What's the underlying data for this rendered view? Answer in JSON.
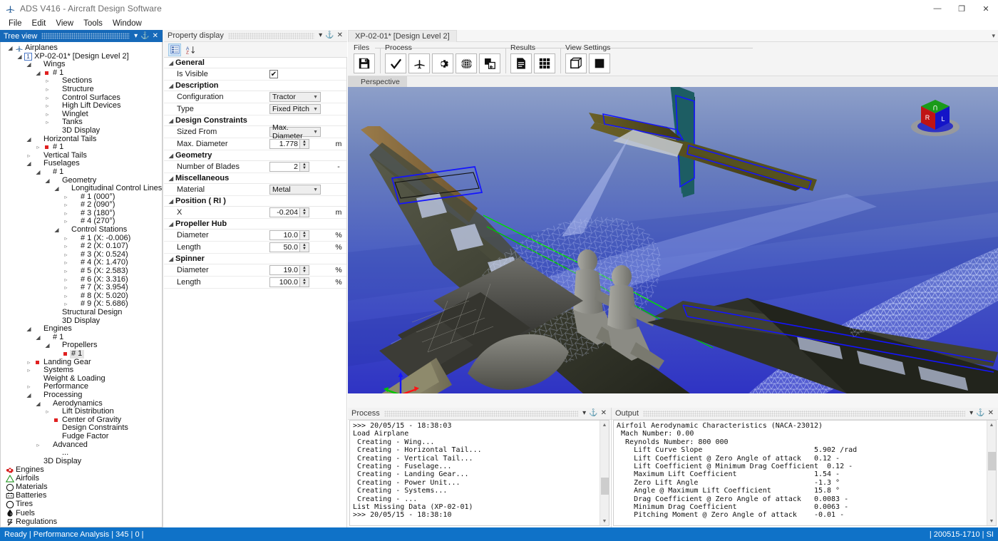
{
  "window": {
    "title": "ADS V416 - Aircraft Design Software",
    "app_icon": "airplane-icon",
    "minimize": "—",
    "maximize": "❐",
    "close": "✕"
  },
  "menu": {
    "items": [
      "File",
      "Edit",
      "View",
      "Tools",
      "Window"
    ]
  },
  "tree_panel": {
    "caption": "Tree view",
    "buttons": {
      "dropdown": "▾",
      "pin": "⚓",
      "close": "✕"
    },
    "nodes": [
      {
        "depth": 0,
        "exp": "open",
        "icon": "airplane-icon",
        "label": "Airplanes"
      },
      {
        "depth": 1,
        "exp": "open",
        "icon": "number-badge-1",
        "label": "XP-02-01* [Design Level 2]"
      },
      {
        "depth": 2,
        "exp": "open",
        "icon": "none",
        "label": "Wings"
      },
      {
        "depth": 3,
        "exp": "open",
        "icon": "red-dot",
        "label": "# 1"
      },
      {
        "depth": 4,
        "exp": "closed",
        "icon": "none",
        "label": "Sections"
      },
      {
        "depth": 4,
        "exp": "closed",
        "icon": "none",
        "label": "Structure"
      },
      {
        "depth": 4,
        "exp": "closed",
        "icon": "none",
        "label": "Control Surfaces"
      },
      {
        "depth": 4,
        "exp": "closed",
        "icon": "none",
        "label": "High Lift Devices"
      },
      {
        "depth": 4,
        "exp": "closed",
        "icon": "none",
        "label": "Winglet"
      },
      {
        "depth": 4,
        "exp": "closed",
        "icon": "none",
        "label": "Tanks"
      },
      {
        "depth": 4,
        "exp": "none",
        "icon": "none",
        "label": "3D Display"
      },
      {
        "depth": 2,
        "exp": "open",
        "icon": "none",
        "label": "Horizontal Tails"
      },
      {
        "depth": 3,
        "exp": "closed",
        "icon": "red-dot",
        "label": "# 1"
      },
      {
        "depth": 2,
        "exp": "closed",
        "icon": "none",
        "label": "Vertical Tails"
      },
      {
        "depth": 2,
        "exp": "open",
        "icon": "none",
        "label": "Fuselages"
      },
      {
        "depth": 3,
        "exp": "open",
        "icon": "none",
        "label": "# 1"
      },
      {
        "depth": 4,
        "exp": "open",
        "icon": "none",
        "label": "Geometry"
      },
      {
        "depth": 5,
        "exp": "open",
        "icon": "none",
        "label": "Longitudinal Control Lines"
      },
      {
        "depth": 6,
        "exp": "closed",
        "icon": "none",
        "label": "# 1 (000°)"
      },
      {
        "depth": 6,
        "exp": "closed",
        "icon": "none",
        "label": "# 2 (090°)"
      },
      {
        "depth": 6,
        "exp": "closed",
        "icon": "none",
        "label": "# 3 (180°)"
      },
      {
        "depth": 6,
        "exp": "closed",
        "icon": "none",
        "label": "# 4 (270°)"
      },
      {
        "depth": 5,
        "exp": "open",
        "icon": "none",
        "label": "Control Stations"
      },
      {
        "depth": 6,
        "exp": "closed",
        "icon": "none",
        "label": "# 1 (X: -0.006)"
      },
      {
        "depth": 6,
        "exp": "closed",
        "icon": "none",
        "label": "# 2 (X: 0.107)"
      },
      {
        "depth": 6,
        "exp": "closed",
        "icon": "none",
        "label": "# 3 (X: 0.524)"
      },
      {
        "depth": 6,
        "exp": "closed",
        "icon": "none",
        "label": "# 4 (X: 1.470)"
      },
      {
        "depth": 6,
        "exp": "closed",
        "icon": "none",
        "label": "# 5 (X: 2.583)"
      },
      {
        "depth": 6,
        "exp": "closed",
        "icon": "none",
        "label": "# 6 (X: 3.316)"
      },
      {
        "depth": 6,
        "exp": "closed",
        "icon": "none",
        "label": "# 7 (X: 3.954)"
      },
      {
        "depth": 6,
        "exp": "closed",
        "icon": "none",
        "label": "# 8 (X: 5.020)"
      },
      {
        "depth": 6,
        "exp": "closed",
        "icon": "none",
        "label": "# 9 (X: 5.686)"
      },
      {
        "depth": 4,
        "exp": "none",
        "icon": "none",
        "label": "Structural Design"
      },
      {
        "depth": 4,
        "exp": "none",
        "icon": "none",
        "label": "3D Display"
      },
      {
        "depth": 2,
        "exp": "open",
        "icon": "none",
        "label": "Engines"
      },
      {
        "depth": 3,
        "exp": "open",
        "icon": "none",
        "label": "# 1"
      },
      {
        "depth": 4,
        "exp": "open",
        "icon": "none",
        "label": "Propellers"
      },
      {
        "depth": 5,
        "exp": "none",
        "icon": "red-dot",
        "label": "# 1",
        "selected": true
      },
      {
        "depth": 2,
        "exp": "closed",
        "icon": "red-dot",
        "label": "Landing Gear"
      },
      {
        "depth": 2,
        "exp": "closed",
        "icon": "none",
        "label": "Systems"
      },
      {
        "depth": 2,
        "exp": "none",
        "icon": "none",
        "label": "Weight & Loading"
      },
      {
        "depth": 2,
        "exp": "closed",
        "icon": "none",
        "label": "Performance"
      },
      {
        "depth": 2,
        "exp": "open",
        "icon": "none",
        "label": "Processing"
      },
      {
        "depth": 3,
        "exp": "open",
        "icon": "none",
        "label": "Aerodynamics"
      },
      {
        "depth": 4,
        "exp": "closed",
        "icon": "none",
        "label": "Lift Distribution"
      },
      {
        "depth": 4,
        "exp": "none",
        "icon": "red-dot",
        "label": "Center of Gravity"
      },
      {
        "depth": 4,
        "exp": "none",
        "icon": "none",
        "label": "Design Constraints"
      },
      {
        "depth": 4,
        "exp": "none",
        "icon": "none",
        "label": "Fudge Factor"
      },
      {
        "depth": 3,
        "exp": "closed",
        "icon": "none",
        "label": "Advanced"
      },
      {
        "depth": 4,
        "exp": "none",
        "icon": "none",
        "label": "..."
      },
      {
        "depth": 2,
        "exp": "none",
        "icon": "none",
        "label": "3D Display"
      }
    ],
    "library": [
      {
        "icon": "engine-icon",
        "label": "Engines"
      },
      {
        "icon": "airfoil-icon",
        "label": "Airfoils"
      },
      {
        "icon": "material-icon",
        "label": "Materials"
      },
      {
        "icon": "battery-icon",
        "label": "Batteries"
      },
      {
        "icon": "tire-icon",
        "label": "Tires"
      },
      {
        "icon": "fuel-icon",
        "label": "Fuels"
      },
      {
        "icon": "regulation-icon",
        "label": "Regulations"
      }
    ]
  },
  "property_panel": {
    "caption": "Property display",
    "buttons": {
      "dropdown": "▾",
      "pin": "⚓",
      "close": "✕"
    },
    "toolbar": [
      {
        "name": "categorized-button",
        "glyph": "☷",
        "active": true
      },
      {
        "name": "sort-alpha-button",
        "glyph": "A↓",
        "active": false
      }
    ],
    "groups": [
      {
        "title": "General",
        "rows": [
          {
            "name": "Is Visible",
            "type": "checkbox",
            "value": "✔",
            "unit": ""
          }
        ]
      },
      {
        "title": "Description",
        "rows": [
          {
            "name": "Configuration",
            "type": "combo",
            "value": "Tractor",
            "unit": ""
          },
          {
            "name": "Type",
            "type": "combo",
            "value": "Fixed Pitch",
            "unit": ""
          }
        ]
      },
      {
        "title": "Design Constraints",
        "rows": [
          {
            "name": "Sized From",
            "type": "combo",
            "value": "Max. Diameter",
            "unit": ""
          },
          {
            "name": "Max. Diameter",
            "type": "spin",
            "value": "1.778",
            "unit": "m"
          }
        ]
      },
      {
        "title": "Geometry",
        "rows": [
          {
            "name": "Number of Blades",
            "type": "spin",
            "value": "2",
            "unit": "-"
          }
        ]
      },
      {
        "title": "Miscellaneous",
        "rows": [
          {
            "name": "Material",
            "type": "combo",
            "value": "Metal",
            "unit": ""
          }
        ]
      },
      {
        "title": "Position ( RI )",
        "rows": [
          {
            "name": "X",
            "type": "spin",
            "value": "-0.204",
            "unit": "m"
          }
        ]
      },
      {
        "title": "Propeller Hub",
        "rows": [
          {
            "name": "Diameter",
            "type": "spin",
            "value": "10.0",
            "unit": "%"
          },
          {
            "name": "Length",
            "type": "spin",
            "value": "50.0",
            "unit": "%"
          }
        ]
      },
      {
        "title": "Spinner",
        "rows": [
          {
            "name": "Diameter",
            "type": "spin",
            "value": "19.0",
            "unit": "%"
          },
          {
            "name": "Length",
            "type": "spin",
            "value": "100.0",
            "unit": "%"
          }
        ]
      }
    ]
  },
  "document": {
    "tab_label": "XP-02-01* [Design Level 2]",
    "dock_button": "▾",
    "ribbon_groups": [
      {
        "title": "Files",
        "buttons": [
          {
            "name": "save-button",
            "icon": "floppy-disk-icon"
          }
        ]
      },
      {
        "title": "Process",
        "buttons": [
          {
            "name": "check-button",
            "icon": "checkmark-icon"
          },
          {
            "name": "airplane-analysis-button",
            "icon": "airplane-icon"
          },
          {
            "name": "settings-button",
            "icon": "gear-icon"
          },
          {
            "name": "mesh-sphere-button",
            "icon": "mesh-sphere-icon"
          },
          {
            "name": "compare-button",
            "icon": "compare-shapes-icon"
          }
        ]
      },
      {
        "title": "Results",
        "buttons": [
          {
            "name": "report-button",
            "icon": "document-icon"
          },
          {
            "name": "table-button",
            "icon": "grid-table-icon"
          }
        ]
      },
      {
        "title": "View Settings",
        "buttons": [
          {
            "name": "bounding-box-button",
            "icon": "cube-outline-icon"
          },
          {
            "name": "solid-fill-button",
            "icon": "filled-square-icon"
          }
        ]
      }
    ],
    "view_tab": "Perspective",
    "viewport": {
      "model_name": "XP-02-01",
      "axis_gizmo": {
        "name": "view-cube",
        "faces": [
          "U",
          "R",
          "L"
        ]
      },
      "axis_triad": {
        "x": "red",
        "y": "green",
        "z": "blue"
      }
    }
  },
  "process_panel": {
    "caption": "Process",
    "buttons": {
      "dropdown": "▾",
      "pin": "⚓",
      "close": "✕"
    },
    "log": ">>> 20/05/15 - 18:38:03\nLoad Airplane\n Creating - Wing...\n Creating - Horizontal Tail...\n Creating - Vertical Tail...\n Creating - Fuselage...\n Creating - Landing Gear...\n Creating - Power Unit...\n Creating - Systems...\n Creating - ...\nList Missing Data (XP-02-01)\n>>> 20/05/15 - 18:38:10"
  },
  "output_panel": {
    "caption": "Output",
    "buttons": {
      "dropdown": "▾",
      "pin": "⚓",
      "close": "✕"
    },
    "log": "Airfoil Aerodynamic Characteristics (NACA-23012)\n Mach Number: 0.00\n  Reynolds Number: 800 000\n    Lift Curve Slope                          5.902 /rad\n    Lift Coefficient @ Zero Angle of attack   0.12 -\n    Lift Coefficient @ Minimum Drag Coefficient  0.12 -\n    Maximum Lift Coefficient                  1.54 -\n    Zero Lift Angle                           -1.3 °\n    Angle @ Maximum Lift Coefficient          15.8 °\n    Drag Coefficient @ Zero Angle of attack   0.0083 -\n    Minimum Drag Coefficient                  0.0063 -\n    Pitching Moment @ Zero Angle of attack    -0.01 -"
  },
  "status_bar": {
    "left": "Ready |  Performance Analysis |  345 |  0 |",
    "right": "| 200515-1710 |  SI"
  },
  "colors": {
    "accent": "#0f72c8",
    "caption_active": "#1669b9",
    "red_marker": "#e02020",
    "sky_top": "#8d9fc9",
    "sky_bottom": "#2f33c4",
    "wireframe": "#b9c6f5"
  }
}
